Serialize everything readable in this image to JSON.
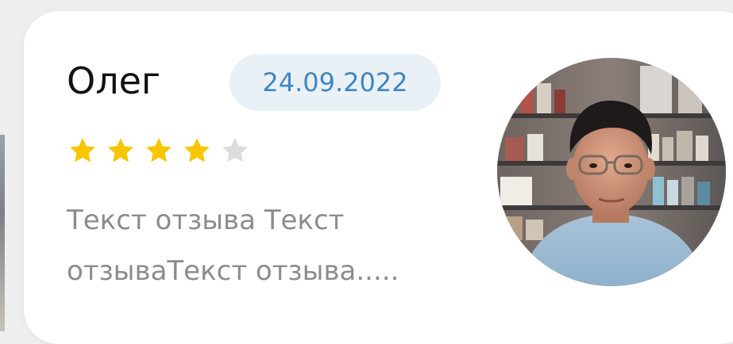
{
  "review": {
    "author_name": "Олег",
    "date": "24.09.2022",
    "rating": 4,
    "max_rating": 5,
    "text_lines": [
      "Текст отзыва Текст",
      "отзываТекст отзыва....."
    ]
  },
  "colors": {
    "star_filled": "#f7c600",
    "star_empty": "#dcdcdc",
    "date_text": "#3f86c4",
    "date_badge_bg": "#eaf1f6",
    "review_text": "#8c8c8c"
  },
  "icons": {
    "star": "star-icon"
  }
}
